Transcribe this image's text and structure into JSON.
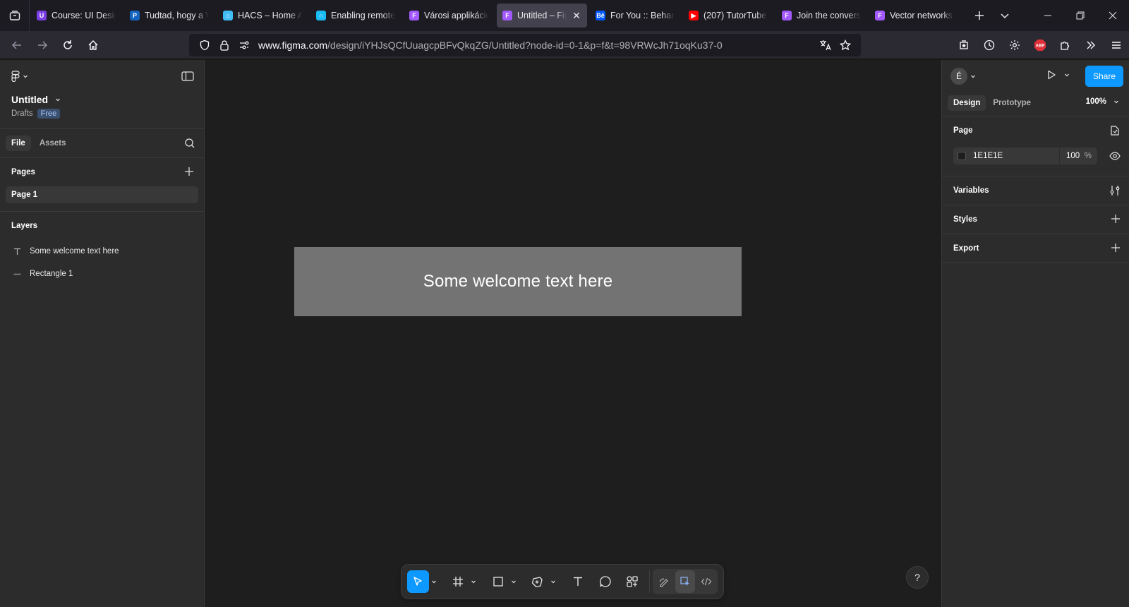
{
  "browser": {
    "tabs": [
      {
        "label": "Course: UI Design",
        "fav_color": "#7b3fe4",
        "fav_char": "U"
      },
      {
        "label": "Tudtad, hogy a Vite",
        "fav_color": "#1565c0",
        "fav_char": "P"
      },
      {
        "label": "HACS – Home Assistant",
        "fav_color": "#41bdf5",
        "fav_char": "⌂"
      },
      {
        "label": "Enabling remote",
        "fav_color": "#18bcf2",
        "fav_char": "∩"
      },
      {
        "label": "Városi applikáció",
        "fav_color": "#a259ff",
        "fav_char": "F"
      },
      {
        "label": "Untitled – Figma",
        "fav_color": "#a259ff",
        "fav_char": "F",
        "active": true
      },
      {
        "label": "For You :: Behance",
        "fav_color": "#0057ff",
        "fav_char": "Bē"
      },
      {
        "label": "(207) TutorTube",
        "fav_color": "#ff0000",
        "fav_char": "▶"
      },
      {
        "label": "Join the conversation",
        "fav_color": "#a259ff",
        "fav_char": "F"
      },
      {
        "label": "Vector networks",
        "fav_color": "#a259ff",
        "fav_char": "F"
      }
    ],
    "url_host": "www.figma.com",
    "url_prefix": "",
    "url_path": "/design/iYHJsQCfUuagcpBFvQkqZG/Untitled?node-id=0-1&p=f&t=98VRWcJh71oqKu37-0"
  },
  "file": {
    "title": "Untitled",
    "location": "Drafts",
    "plan_badge": "Free"
  },
  "left_panel": {
    "tabs": [
      "File",
      "Assets"
    ],
    "pages_heading": "Pages",
    "pages": [
      "Page 1"
    ],
    "layers_heading": "Layers",
    "layers": [
      {
        "name": "Some welcome text here",
        "icon": "text-layer-icon"
      },
      {
        "name": "Rectangle 1",
        "icon": "rectangle-layer-icon"
      }
    ]
  },
  "canvas": {
    "welcome_text": "Some welcome text here",
    "rect_color": "#737373",
    "bg_color": "#1e1e1e"
  },
  "right_panel": {
    "avatar_initial": "É",
    "share_label": "Share",
    "tabs": [
      "Design",
      "Prototype"
    ],
    "zoom": "100%",
    "page_heading": "Page",
    "page_fill_hex": "1E1E1E",
    "page_fill_opacity": "100",
    "page_fill_pct": "%",
    "variables_heading": "Variables",
    "styles_heading": "Styles",
    "export_heading": "Export"
  },
  "help_label": "?",
  "colors": {
    "accent": "#0d99ff",
    "panel": "#2c2c2c"
  }
}
